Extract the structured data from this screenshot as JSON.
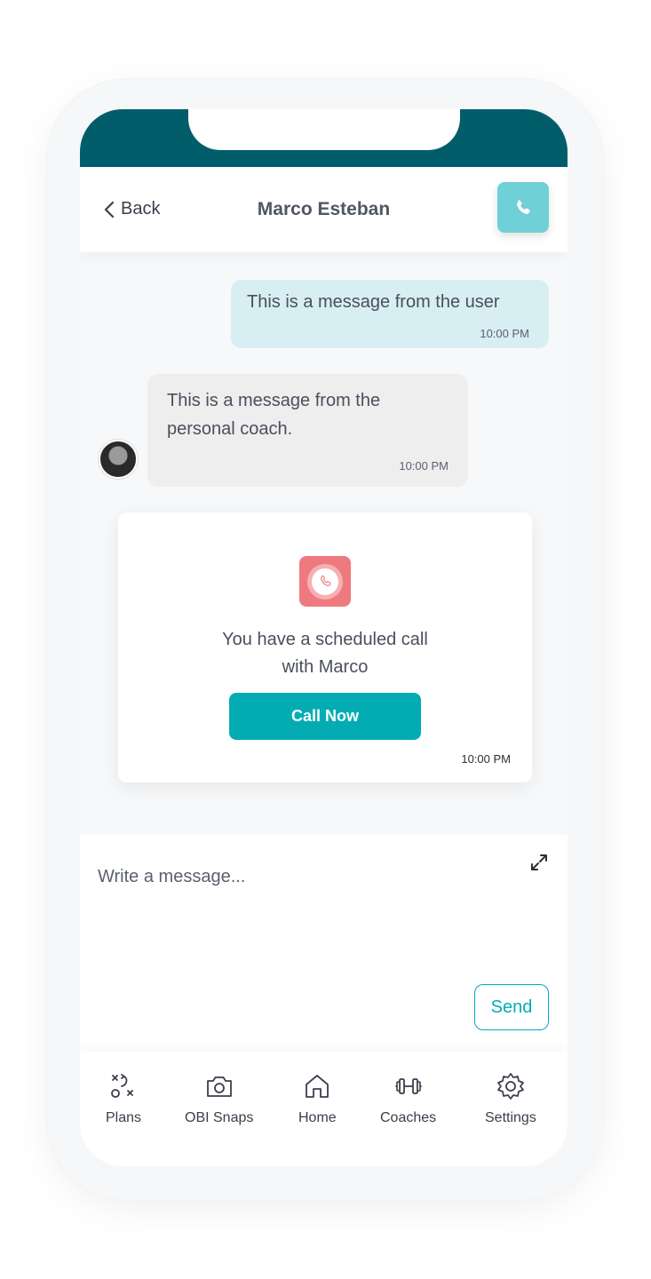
{
  "header": {
    "back_label": "Back",
    "title": "Marco Esteban"
  },
  "messages": [
    {
      "from": "user",
      "text": "This is a message from the user",
      "time": "10:00 PM"
    },
    {
      "from": "coach",
      "text": "This is a message from the personal coach.",
      "time": "10:00 PM"
    }
  ],
  "call_card": {
    "line1": "You have a scheduled call",
    "line2": "with Marco",
    "button_label": "Call Now",
    "time": "10:00 PM"
  },
  "composer": {
    "placeholder": "Write a message...",
    "send_label": "Send"
  },
  "tabs": [
    {
      "label": "Plans",
      "icon": "plans-icon"
    },
    {
      "label": "OBI Snaps",
      "icon": "camera-icon"
    },
    {
      "label": "Home",
      "icon": "home-icon"
    },
    {
      "label": "Coaches",
      "icon": "dumbbell-icon"
    },
    {
      "label": "Settings",
      "icon": "gear-icon"
    }
  ],
  "colors": {
    "status_bar": "#025d6b",
    "call_button": "#6fd0d7",
    "user_bubble": "#d7eff2",
    "coach_bubble": "#eeeeee",
    "primary": "#03acb3",
    "call_badge": "#ee7a80"
  }
}
